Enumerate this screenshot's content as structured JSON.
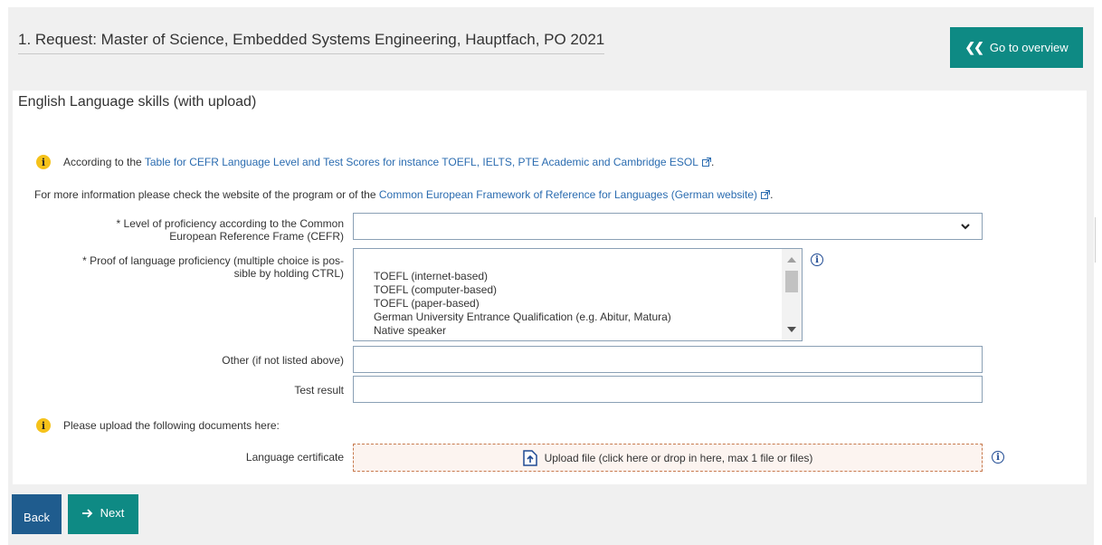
{
  "header": {
    "title": "1. Request: Master of Science, Embedded Systems Engineering, Hauptfach, PO 2021",
    "overview_button": "Go to overview"
  },
  "section": {
    "title": "English Language skills (with upload)"
  },
  "info": {
    "cefr_prefix": "According to the ",
    "cefr_link": "Table for CEFR Language Level and Test Scores for instance TOEFL, IELTS, PTE Academic and Cambridge ESOL",
    "cefr_suffix": ".",
    "more_prefix": "For more information please check the website of the program or of the ",
    "more_link": "Common European Framework of Reference for Languages (German website)",
    "more_suffix": "."
  },
  "form": {
    "level_label_line1": "* Level of proficiency according to the Common",
    "level_label_line2": "European Reference Frame (CEFR)",
    "level_value": "",
    "proof_label_line1": "* Proof of language proficiency (multiple choice is pos-",
    "proof_label_line2": "sible by holding CTRL)",
    "proof_options": [
      "TOEFL (internet-based)",
      "TOEFL (computer-based)",
      "TOEFL (paper-based)",
      "German University Entrance Qualification (e.g. Abitur, Matura)",
      "Native speaker"
    ],
    "other_label": "Other (if not listed above)",
    "other_value": "",
    "test_result_label": "Test result",
    "test_result_value": ""
  },
  "upload": {
    "notice": "Please upload the following documents here:",
    "certificate_label": "Language certificate",
    "dropzone_text": "Upload file (click here or drop in here, max 1 file or files)"
  },
  "footer": {
    "back_label": "Back",
    "next_label": "Next"
  },
  "colors": {
    "teal": "#0e8a84",
    "navy": "#1f5c8e",
    "info_yellow": "#f5c21a",
    "link_blue": "#2b6cb0"
  }
}
